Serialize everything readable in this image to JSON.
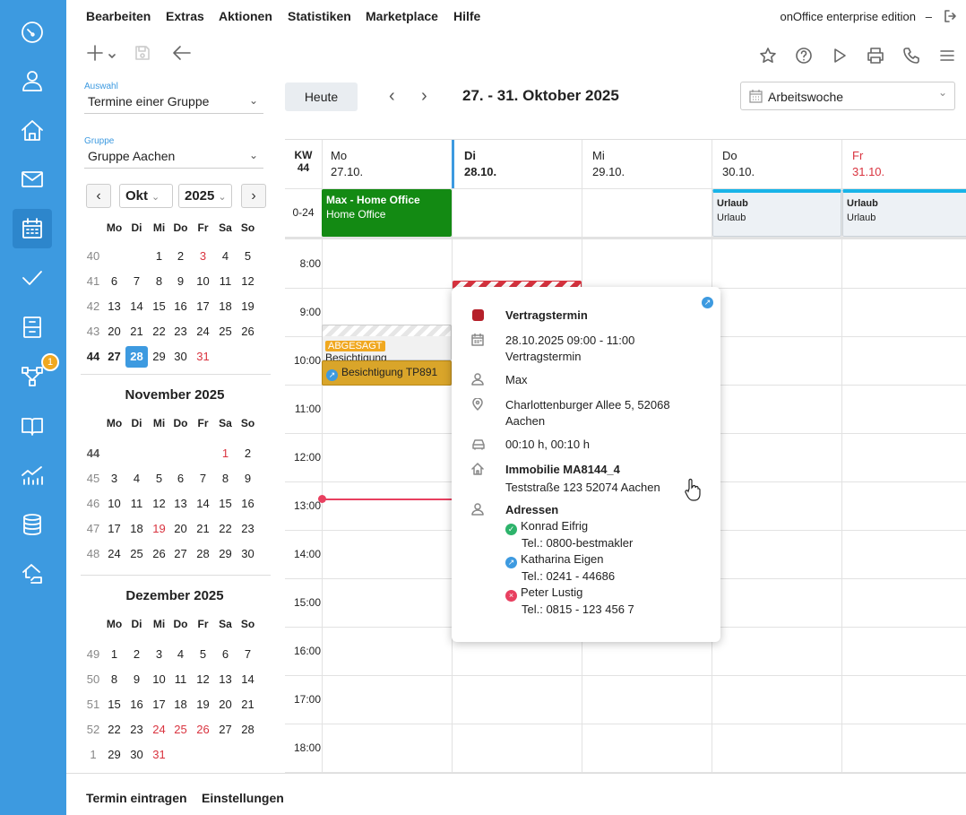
{
  "menu": {
    "items": [
      "Bearbeiten",
      "Extras",
      "Aktionen",
      "Statistiken",
      "Marketplace",
      "Hilfe"
    ],
    "edition": "onOffice enterprise edition",
    "separator": "–"
  },
  "sidebar": {
    "badge": "1",
    "icons": [
      "speedometer-icon",
      "user-icon",
      "home-icon",
      "mail-icon",
      "calendar-icon",
      "check-icon",
      "cabinet-icon",
      "workflow-icon",
      "book-icon",
      "chart-icon",
      "database-icon",
      "house-hand-icon"
    ]
  },
  "left": {
    "auswahl_label": "Auswahl",
    "auswahl_value": "Termine einer Gruppe",
    "gruppe_label": "Gruppe",
    "gruppe_value": "Gruppe Aachen",
    "month_select": "Okt",
    "year_select": "2025",
    "weekday_headers": [
      "Mo",
      "Di",
      "Mi",
      "Do",
      "Fr",
      "Sa",
      "So"
    ],
    "oct_weeks": [
      {
        "wk": "40",
        "days": [
          "",
          "",
          "1",
          "2",
          "3",
          "4",
          "5"
        ]
      },
      {
        "wk": "41",
        "days": [
          "6",
          "7",
          "8",
          "9",
          "10",
          "11",
          "12"
        ]
      },
      {
        "wk": "42",
        "days": [
          "13",
          "14",
          "15",
          "16",
          "17",
          "18",
          "19"
        ]
      },
      {
        "wk": "43",
        "days": [
          "20",
          "21",
          "22",
          "23",
          "24",
          "25",
          "26"
        ]
      },
      {
        "wk": "44",
        "days": [
          "27",
          "28",
          "29",
          "30",
          "31",
          "",
          ""
        ]
      }
    ],
    "nov_title": "November 2025",
    "nov_weeks": [
      {
        "wk": "44",
        "days": [
          "",
          "",
          "",
          "",
          "",
          "1",
          "2"
        ]
      },
      {
        "wk": "45",
        "days": [
          "3",
          "4",
          "5",
          "6",
          "7",
          "8",
          "9"
        ]
      },
      {
        "wk": "46",
        "days": [
          "10",
          "11",
          "12",
          "13",
          "14",
          "15",
          "16"
        ]
      },
      {
        "wk": "47",
        "days": [
          "17",
          "18",
          "19",
          "20",
          "21",
          "22",
          "23"
        ]
      },
      {
        "wk": "48",
        "days": [
          "24",
          "25",
          "26",
          "27",
          "28",
          "29",
          "30"
        ]
      }
    ],
    "dec_title": "Dezember 2025",
    "dec_weeks": [
      {
        "wk": "49",
        "days": [
          "1",
          "2",
          "3",
          "4",
          "5",
          "6",
          "7"
        ]
      },
      {
        "wk": "50",
        "days": [
          "8",
          "9",
          "10",
          "11",
          "12",
          "13",
          "14"
        ]
      },
      {
        "wk": "51",
        "days": [
          "15",
          "16",
          "17",
          "18",
          "19",
          "20",
          "21"
        ]
      },
      {
        "wk": "52",
        "days": [
          "22",
          "23",
          "24",
          "25",
          "26",
          "27",
          "28"
        ]
      },
      {
        "wk": "1",
        "days": [
          "29",
          "30",
          "31",
          "",
          "",
          "",
          ""
        ]
      }
    ]
  },
  "header": {
    "today_button": "Heute",
    "range_title": "27. - 31. Oktober 2025",
    "view_select": "Arbeitswoche"
  },
  "grid": {
    "kw_label": "KW",
    "kw_value": "44",
    "allday_label": "0-24",
    "days": [
      {
        "name": "Mo",
        "date": "27.10."
      },
      {
        "name": "Di",
        "date": "28.10."
      },
      {
        "name": "Mi",
        "date": "29.10."
      },
      {
        "name": "Do",
        "date": "30.10."
      },
      {
        "name": "Fr",
        "date": "31.10."
      }
    ],
    "times": [
      "8:00",
      "9:00",
      "10:00",
      "11:00",
      "12:00",
      "13:00",
      "14:00",
      "15:00",
      "16:00",
      "17:00",
      "18:00"
    ],
    "events": {
      "homeoffice_title": "Max - Home Office",
      "homeoffice_sub": "Home Office",
      "urlaub1_title": "Urlaub",
      "urlaub1_sub": "Urlaub",
      "urlaub2_title": "Urlaub",
      "urlaub2_sub": "Urlaub",
      "cancel_badge": "ABGESAGT",
      "cancel_title": "Besichtigung",
      "besichtigung_title": "Besichtigung TP891"
    }
  },
  "popup": {
    "title": "Vertragstermin",
    "datetime": "28.10.2025 09:00 - 11:00",
    "type": "Vertragstermin",
    "user": "Max",
    "address_line1": "Charlottenburger Allee 5, 52068",
    "address_line2": "Aachen",
    "travel": "00:10 h, 00:10 h",
    "property_title": "Immobilie MA8144_4",
    "property_address": "Teststraße 123 52074 Aachen",
    "addresses_title": "Adressen",
    "contacts": [
      {
        "name": "Konrad Eifrig",
        "phone": "Tel.: 0800-bestmakler"
      },
      {
        "name": "Katharina Eigen",
        "phone": "Tel.: 0241 - 44686"
      },
      {
        "name": "Peter Lustig",
        "phone": "Tel.: 0815 - 123 456 7"
      }
    ]
  },
  "bottom": {
    "add_appointment": "Termin eintragen",
    "settings": "Einstellungen"
  },
  "colors": {
    "accent": "#3d9ae0",
    "green_event": "#138a13",
    "gold_event": "#d9a52a",
    "red": "#d9333f",
    "urlaub_bar": "#19b4e8"
  }
}
